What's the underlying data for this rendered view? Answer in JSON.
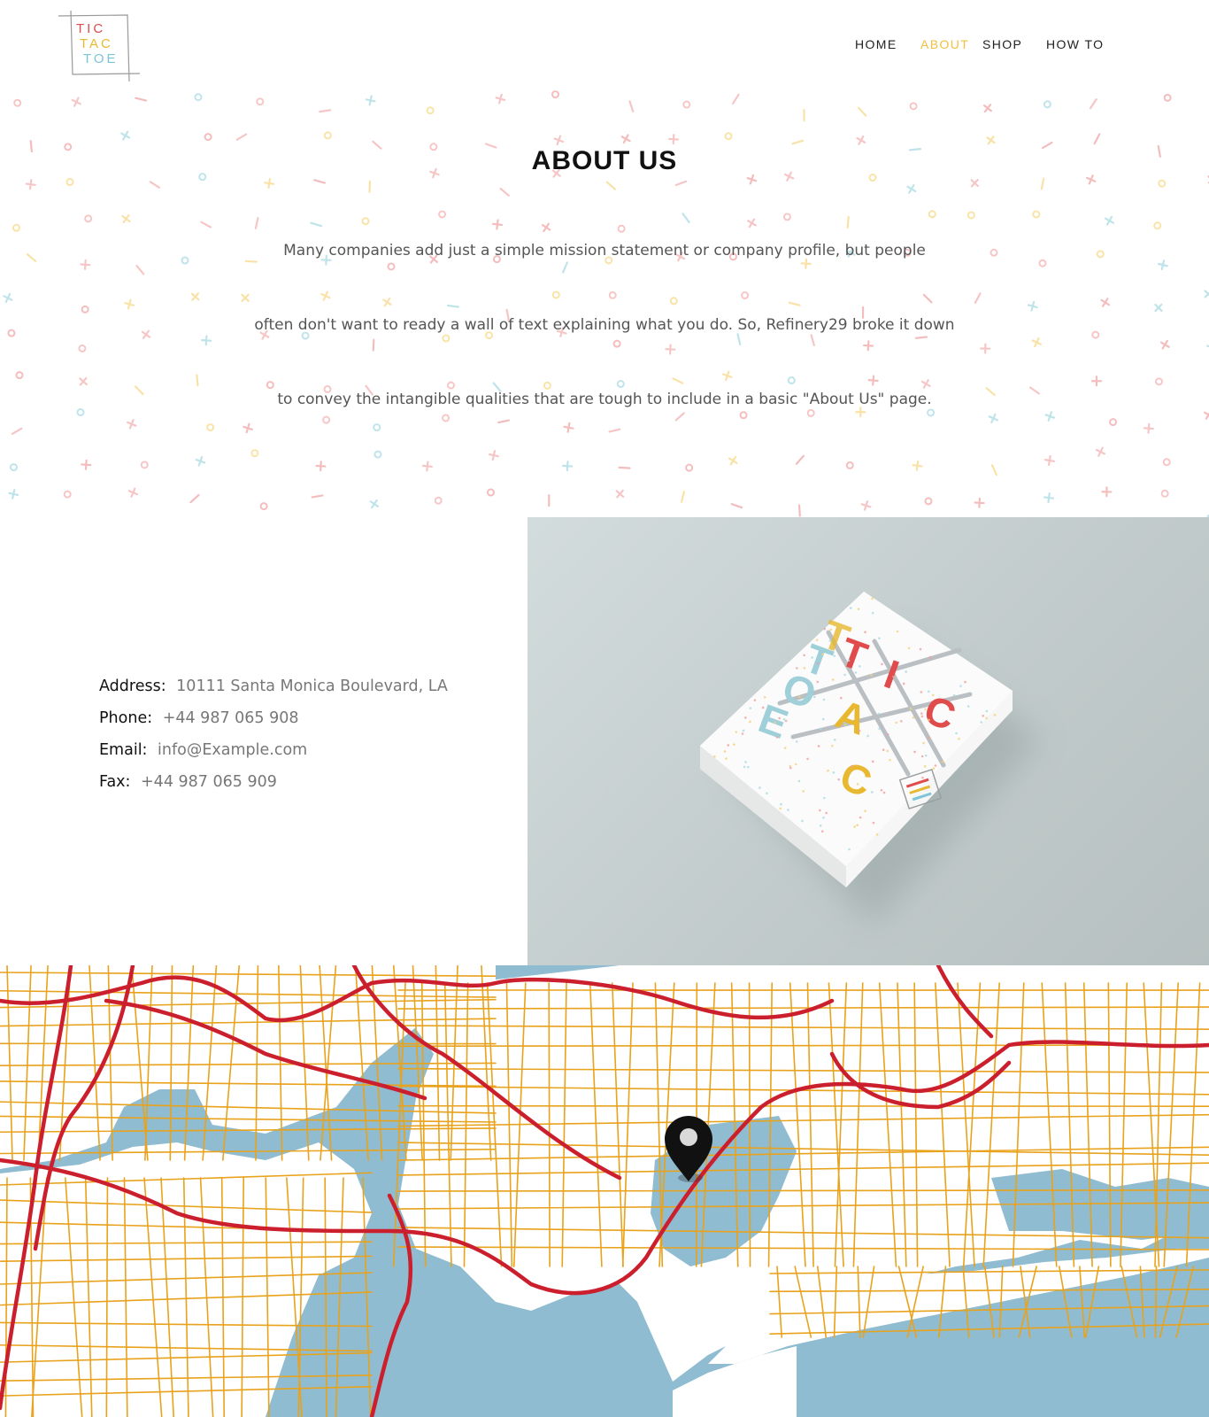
{
  "brand": {
    "logo_lines": [
      "TIC",
      "TAC",
      "TOE"
    ],
    "colors": {
      "red": "#e04b4b",
      "yellow": "#e8b830",
      "blue": "#7cc5d8"
    }
  },
  "nav": {
    "items": [
      {
        "label": "HOME",
        "active": false
      },
      {
        "label": "ABOUT",
        "active": true
      },
      {
        "label": "SHOP",
        "active": false
      },
      {
        "label": "HOW TO",
        "active": false
      }
    ],
    "active_color": "#f0c040"
  },
  "about": {
    "title": "ABOUT US",
    "lines": [
      "Many companies add just a simple mission statement or company profile,  but people",
      "often don't want to ready a wall of text explaining what you do. So, Refinery29 broke it down",
      "to convey the intangible qualities that are tough to include in a basic \"About Us\" page."
    ]
  },
  "contact": {
    "address_label": "Address:",
    "address": "10111 Santa Monica Boulevard, LA",
    "phone_label": "Phone:",
    "phone": "+44 987 065 908",
    "email_label": "Email:",
    "email": "info@Example.com",
    "fax_label": "Fax:",
    "fax": "+44 987 065 909"
  },
  "product": {
    "box_letters": [
      "T",
      "I",
      "C",
      "T",
      "A",
      "C",
      "T",
      "O",
      "E"
    ]
  },
  "map": {
    "icon": "map-pin-icon",
    "colors": {
      "water": "#8fbcd1",
      "land": "#ffffff",
      "street": "#e8a21c",
      "highway": "#cc1f2d"
    }
  }
}
